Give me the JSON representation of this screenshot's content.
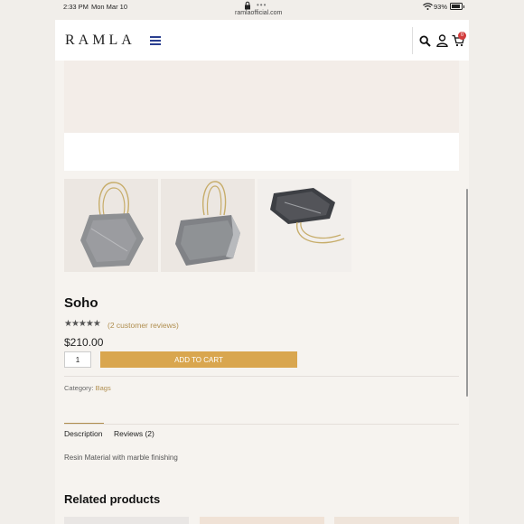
{
  "status_bar": {
    "time": "2:33 PM",
    "date": "Mon Mar 10",
    "url": "ramlaofficial.com",
    "battery_pct": "93%",
    "battery_level": 0.93
  },
  "header": {
    "logo": "RAMLA",
    "cart_count": "0"
  },
  "product": {
    "title": "Soho",
    "stars": "★★★★★",
    "rating": 5,
    "reviews_link": "(2 customer reviews)",
    "price": "$210.00",
    "quantity": "1",
    "add_to_cart_label": "ADD TO CART",
    "category_label": "Category:",
    "category_value": "Bags"
  },
  "tabs": [
    {
      "label": "Description",
      "active": true
    },
    {
      "label": "Reviews (2)",
      "active": false
    }
  ],
  "description_text": "Resin Material with marble finishing",
  "related_heading": "Related products",
  "colors": {
    "accent_gold": "#d9a64f",
    "link_gold": "#b08e4f",
    "menu_blue": "#2a3f8f",
    "badge_red": "#d23c3c"
  },
  "icons": [
    "lock-icon",
    "wifi-icon",
    "battery-icon",
    "hamburger-icon",
    "search-icon",
    "user-icon",
    "cart-icon"
  ]
}
